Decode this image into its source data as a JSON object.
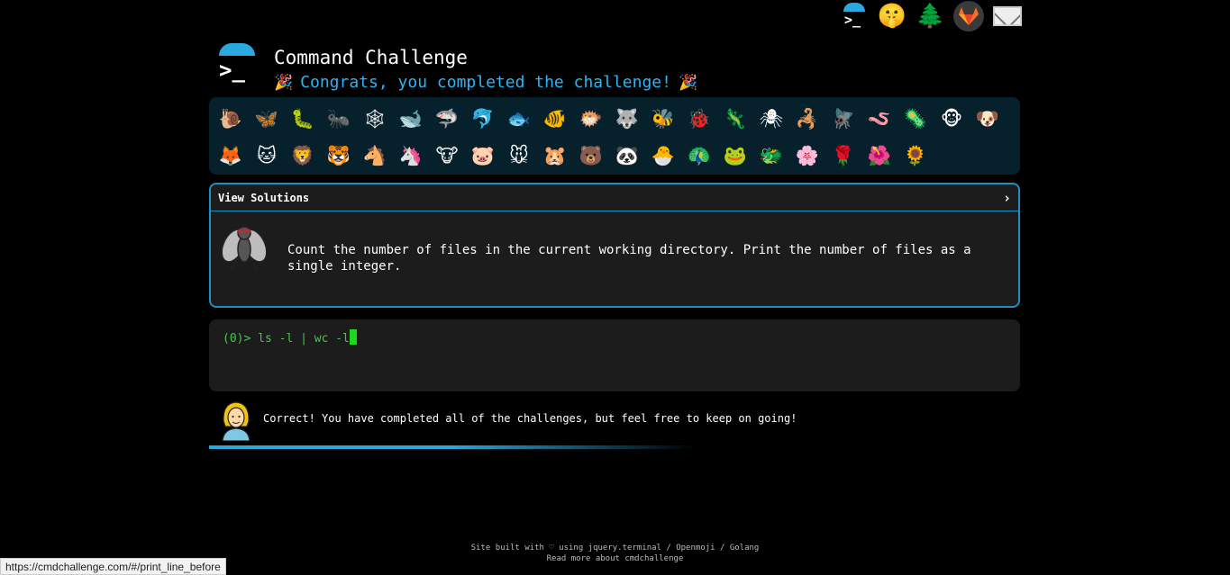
{
  "nav": {
    "logo_prompt": ">_",
    "icons": [
      "terminal-logo-icon",
      "shushing-face-icon",
      "evergreen-tree-icon",
      "gitlab-icon",
      "envelope-icon"
    ],
    "shushing_face": "🤫",
    "tree": "🌲"
  },
  "header": {
    "logo_prompt": ">_",
    "title": "Command Challenge",
    "party_left": "🎉",
    "subtitle": "Congrats, you completed the challenge!",
    "party_right": "🎉"
  },
  "grid": {
    "row1": [
      "🐌",
      "🦋",
      "🐛",
      "🐜",
      "🕸",
      "🐋",
      "🦈",
      "🐬",
      "🐟",
      "🐠",
      "🐡",
      "🐺",
      "🐝",
      "🐞",
      "🦎",
      "🕷",
      "🦂",
      "🪰",
      "🪱",
      "🦠",
      "🐵",
      "🐶"
    ],
    "row2": [
      "🦊",
      "🐱",
      "🦁",
      "🐯",
      "🐴",
      "🦄",
      "🐮",
      "🐷",
      "🐭",
      "🐹",
      "🐻",
      "🐼",
      "🐣",
      "🦚",
      "🐸",
      "🐲",
      "🌸",
      "🌹",
      "🌺",
      "🌻"
    ]
  },
  "challenge": {
    "solutions_label": "View Solutions",
    "chevron": "›",
    "description": "Count the number of files in the current working directory. Print the number of files as a single integer."
  },
  "terminal": {
    "prompt": "(0)>",
    "command": "ls -l | wc -l"
  },
  "result": {
    "message": "Correct! You have completed all of the challenges, but feel free to keep on going!",
    "progress": 0.5
  },
  "footer": {
    "prefix": "Site built with ♡ using ",
    "link_terminal": "jquery.terminal",
    "sep1": " / ",
    "link_openmoji": "Openmoji",
    "sep2": " / ",
    "link_golang": "Golang",
    "about": "Read more about cmdchallenge"
  },
  "status_url": "https://cmdchallenge.com/#/print_line_before",
  "colors": {
    "accent": "#29a9e0",
    "terminal_green": "#49c54e",
    "panel": "#1c1c1c",
    "grid_bg": "#06202c"
  }
}
